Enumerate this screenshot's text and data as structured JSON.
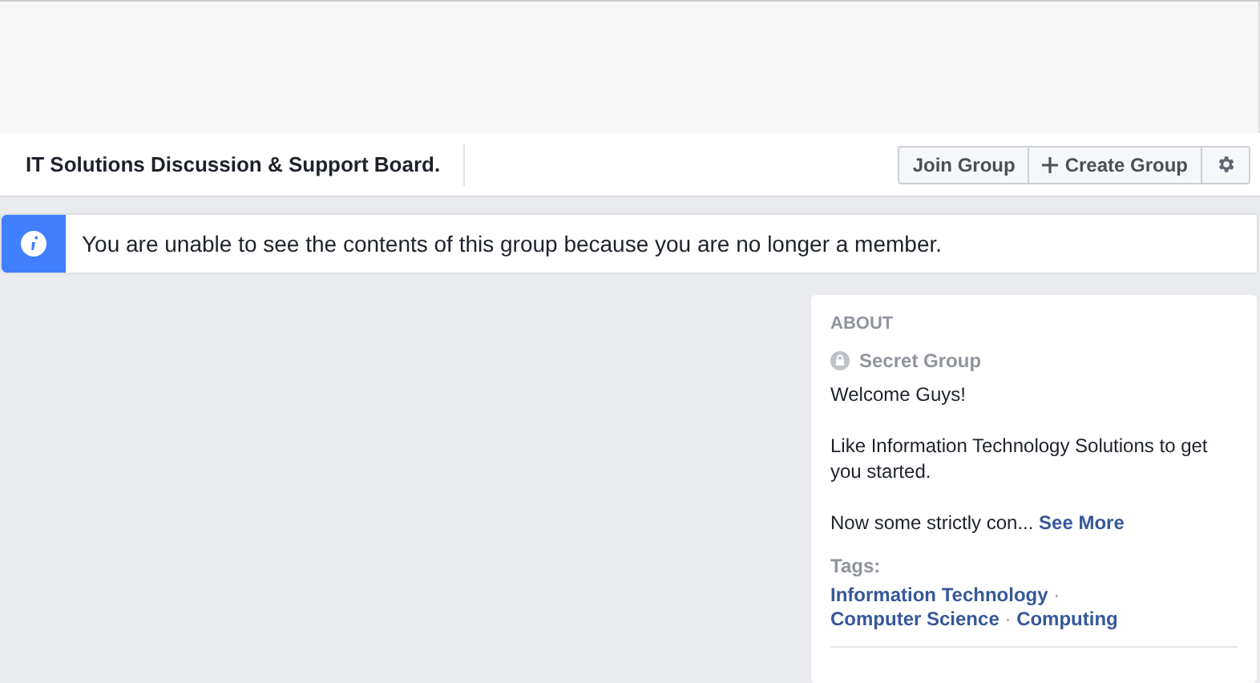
{
  "header": {
    "group_name": "IT Solutions Discussion & Support Board.",
    "buttons": [
      {
        "label": "Join Group",
        "kind": "text"
      },
      {
        "label": "Create Group",
        "kind": "plus"
      },
      {
        "kind": "gear"
      }
    ]
  },
  "notice": {
    "text": "You are unable to see the contents of this group because you are no longer a member."
  },
  "about": {
    "heading": "ABOUT",
    "privacy": "Secret Group",
    "paragraphs": [
      "Welcome Guys!",
      "Like Information Technology Solutions to get you started."
    ],
    "truncated": "Now some strictly con...",
    "see_more": "See More",
    "tags_label": "Tags:",
    "tags": [
      "Information Technology",
      "Computer Science",
      "Computing"
    ],
    "separator": "·"
  }
}
